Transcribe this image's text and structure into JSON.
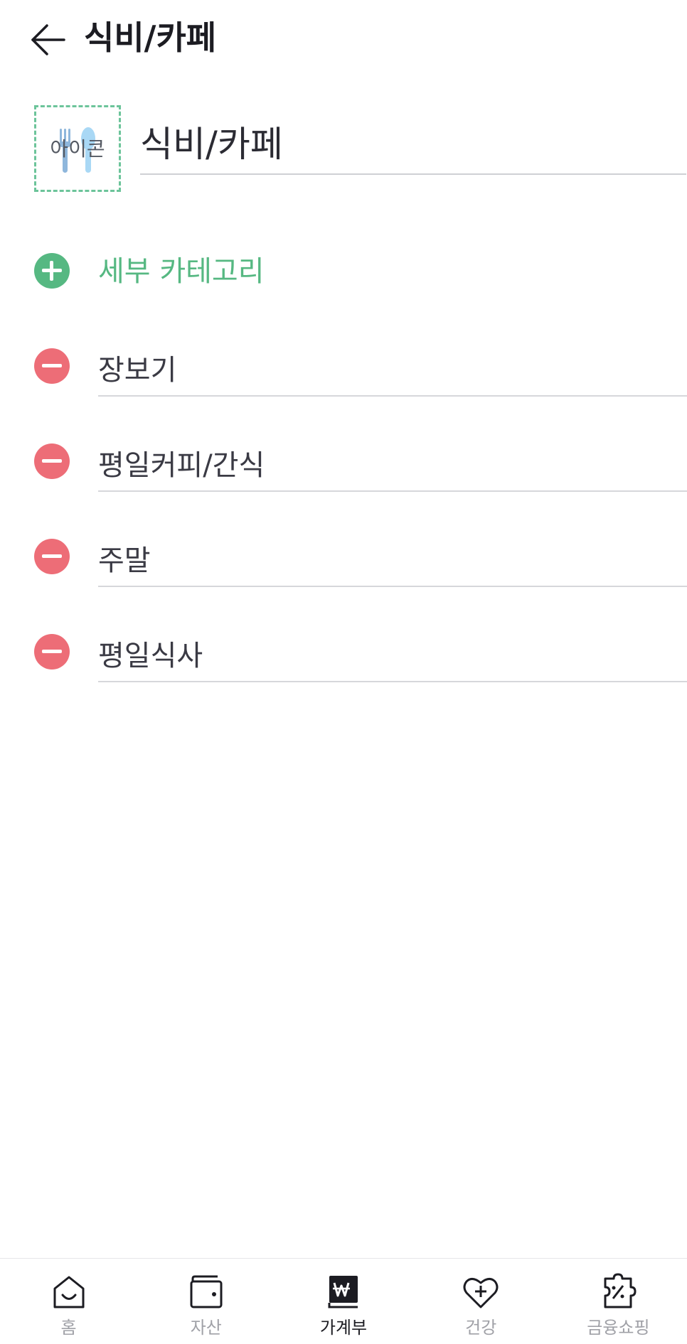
{
  "header": {
    "title": "식비/카페"
  },
  "category": {
    "icon_label": "아이콘",
    "name_value": "식비/카페"
  },
  "add_subcategory": {
    "label": "세부 카테고리"
  },
  "subcategories": [
    {
      "label": "장보기"
    },
    {
      "label": "평일커피/간식"
    },
    {
      "label": "주말"
    },
    {
      "label": "평일식사"
    }
  ],
  "nav": {
    "items": [
      {
        "label": "홈",
        "icon": "home-icon"
      },
      {
        "label": "자산",
        "icon": "wallet-icon"
      },
      {
        "label": "가계부",
        "icon": "ledger-icon",
        "active": true
      },
      {
        "label": "건강",
        "icon": "heart-plus-icon"
      },
      {
        "label": "금융쇼핑",
        "icon": "coupon-icon"
      }
    ]
  },
  "colors": {
    "accent_green": "#56b882",
    "remove_red": "#ed6d77",
    "dashed_border": "#6cc49a"
  }
}
